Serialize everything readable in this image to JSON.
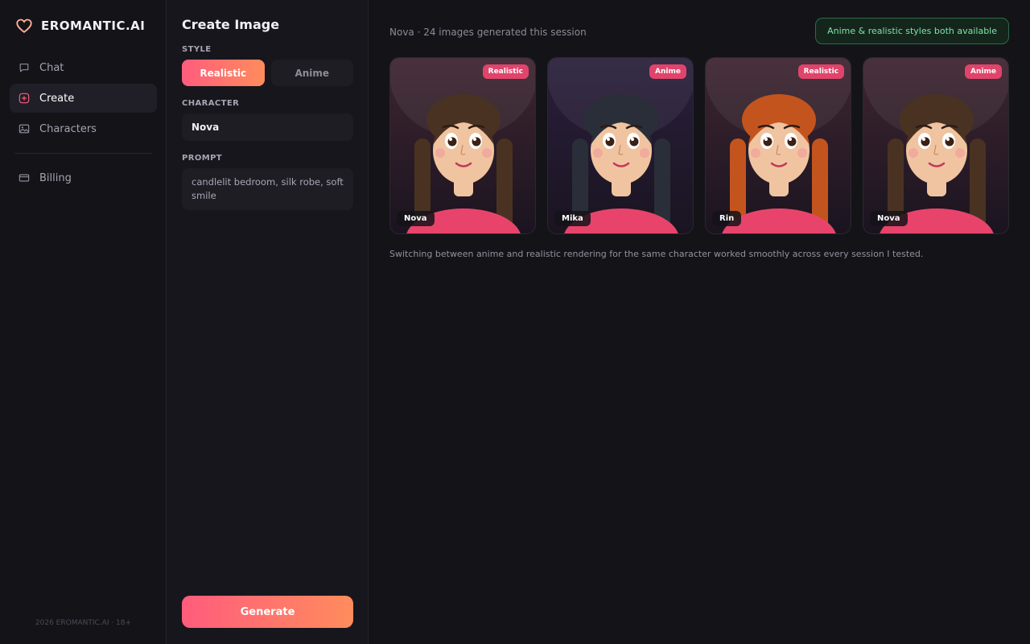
{
  "brand": {
    "name": "EROMANTIC.AI",
    "icon": "heart-icon"
  },
  "nav": {
    "items": [
      {
        "label": "Chat",
        "icon": "chat-icon",
        "active": false
      },
      {
        "label": "Create",
        "icon": "plus-circle-icon",
        "active": true
      },
      {
        "label": "Characters",
        "icon": "image-icon",
        "active": false
      },
      {
        "label": "Billing",
        "icon": "card-icon",
        "active": false
      }
    ]
  },
  "footer": "2026 EROMANTIC.AI · 18+",
  "panel": {
    "title": "Create Image",
    "style_label": "STYLE",
    "styles": [
      {
        "label": "Realistic",
        "selected": true
      },
      {
        "label": "Anime",
        "selected": false
      }
    ],
    "character_label": "CHARACTER",
    "character_value": "Nova",
    "prompt_label": "PROMPT",
    "prompt_value": "candlelit bedroom, silk robe, soft smile",
    "generate_label": "Generate"
  },
  "main": {
    "session_line": "Nova · 24 images generated this session",
    "style_pill": "Anime & realistic styles both available",
    "cards": [
      {
        "badge": "Realistic",
        "name": "Nova",
        "hair": "#4a3222",
        "bg": "#3e2530"
      },
      {
        "badge": "Anime",
        "name": "Mika",
        "hair": "#2a2e38",
        "bg": "#2a1f3c"
      },
      {
        "badge": "Realistic",
        "name": "Rin",
        "hair": "#c4541e",
        "bg": "#3e2530"
      },
      {
        "badge": "Anime",
        "name": "Nova",
        "hair": "#4a3222",
        "bg": "#3e2530"
      }
    ],
    "caption": "Switching between anime and realistic rendering for the same character worked smoothly across every session I tested."
  },
  "colors": {
    "accent_start": "#ff5c7c",
    "accent_end": "#ff8c5c",
    "badge": "#e0446b",
    "success": "#7fe3a6"
  }
}
